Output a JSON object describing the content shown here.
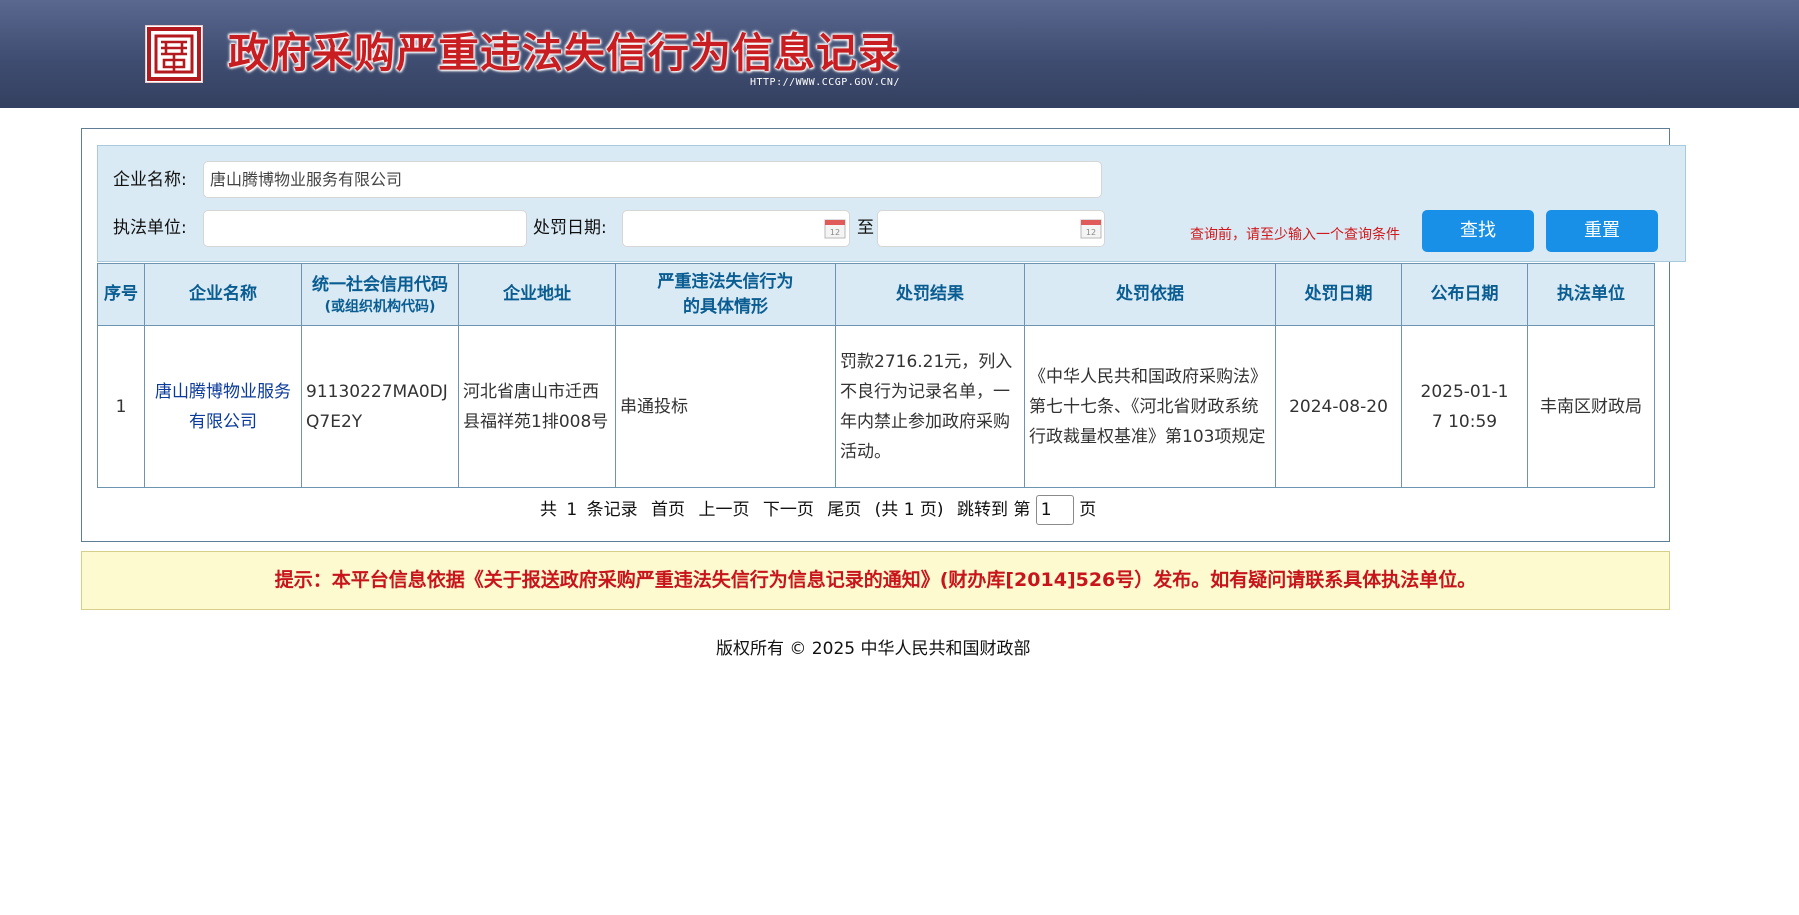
{
  "header": {
    "title": "政府采购严重违法失信行为信息记录",
    "url": "HTTP://WWW.CCGP.GOV.CN/"
  },
  "search": {
    "company_label": "企业名称:",
    "company_value": "唐山腾博物业服务有限公司",
    "agency_label": "执法单位:",
    "agency_value": "",
    "date_label": "处罚日期:",
    "date_from": "",
    "date_to_label": "至",
    "date_to": "",
    "hint": "查询前，请至少输入一个查询条件",
    "search_button": "查找",
    "reset_button": "重置"
  },
  "table": {
    "headers": {
      "seq": "序号",
      "company": "企业名称",
      "credit_code": "统一社会信用代码",
      "credit_code_sub": "(或组织机构代码)",
      "address": "企业地址",
      "situation_line1": "严重违法失信行为",
      "situation_line2": "的具体情形",
      "result": "处罚结果",
      "basis": "处罚依据",
      "penalty_date": "处罚日期",
      "publish_date": "公布日期",
      "agency": "执法单位"
    },
    "rows": [
      {
        "seq": "1",
        "company": "唐山腾博物业服务有限公司",
        "credit_code": "91130227MA0DJQ7E2Y",
        "address": "河北省唐山市迁西县福祥苑1排008号",
        "situation": "串通投标",
        "result": "罚款2716.21元，列入不良行为记录名单，一年内禁止参加政府采购活动。",
        "basis": "《中华人民共和国政府采购法》第七十七条、《河北省财政系统行政裁量权基准》第103项规定",
        "penalty_date": "2024-08-20",
        "publish_date": "2025-01-17 10:59",
        "agency": "丰南区财政局"
      }
    ]
  },
  "pager": {
    "total_prefix": "共",
    "total_count": "1",
    "total_suffix": "条记录",
    "first": "首页",
    "prev": "上一页",
    "next": "下一页",
    "last": "尾页",
    "pages_text": "(共 1 页)",
    "jump_prefix": "跳转到 第",
    "jump_value": "1",
    "jump_suffix": "页"
  },
  "notice": "提示：本平台信息依据《关于报送政府采购严重违法失信行为信息记录的通知》(财办库[2014]526号）发布。如有疑问请联系具体执法单位。",
  "footer": "版权所有 © 2025 中华人民共和国财政部",
  "colors": {
    "title_red": "#c81e22",
    "button_blue": "#1890e8",
    "header_text_blue": "#0a5d92",
    "notice_red": "#c8141b"
  }
}
